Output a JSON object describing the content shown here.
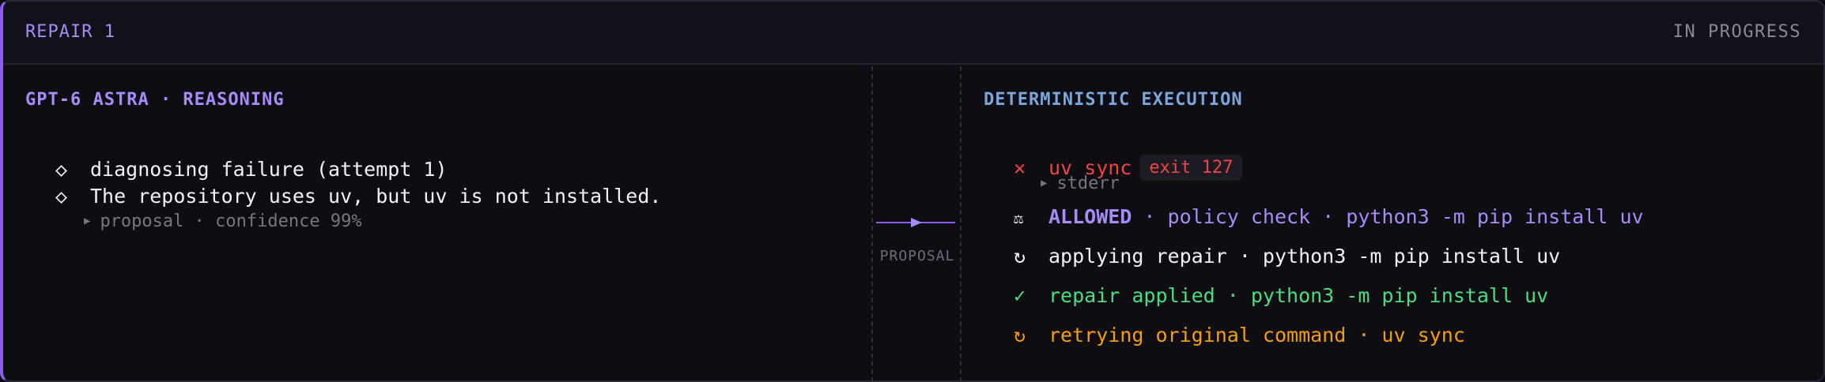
{
  "header": {
    "title": "REPAIR 1",
    "status": "IN PROGRESS"
  },
  "reasoning": {
    "title": "GPT-6 ASTRA · REASONING",
    "items": [
      {
        "bullet": "◇",
        "text": "diagnosing failure (attempt 1)"
      },
      {
        "bullet": "◇",
        "text": "The repository uses uv, but uv is not installed."
      }
    ],
    "proposal_disclosure": "proposal · confidence 99%"
  },
  "connector": {
    "label": "PROPOSAL"
  },
  "execution": {
    "title": "DETERMINISTIC EXECUTION",
    "steps": [
      {
        "icon": "✕",
        "text": "uv sync",
        "badge": "exit 127",
        "disclosure": "stderr"
      },
      {
        "icon": "⚖",
        "verdict": "ALLOWED",
        "text": " · policy check · python3 -m pip install uv"
      },
      {
        "icon": "↻",
        "text": "applying repair · python3 -m pip install uv"
      },
      {
        "icon": "✓",
        "text": "repair applied · python3 -m pip install uv"
      },
      {
        "icon": "↻",
        "text": "retrying original command · uv sync"
      }
    ]
  },
  "colors": {
    "accent": "#a78bfa",
    "execution_title": "#7aa6dc",
    "error": "#ef4444",
    "success": "#4ade80",
    "warning": "#f59e0b"
  }
}
